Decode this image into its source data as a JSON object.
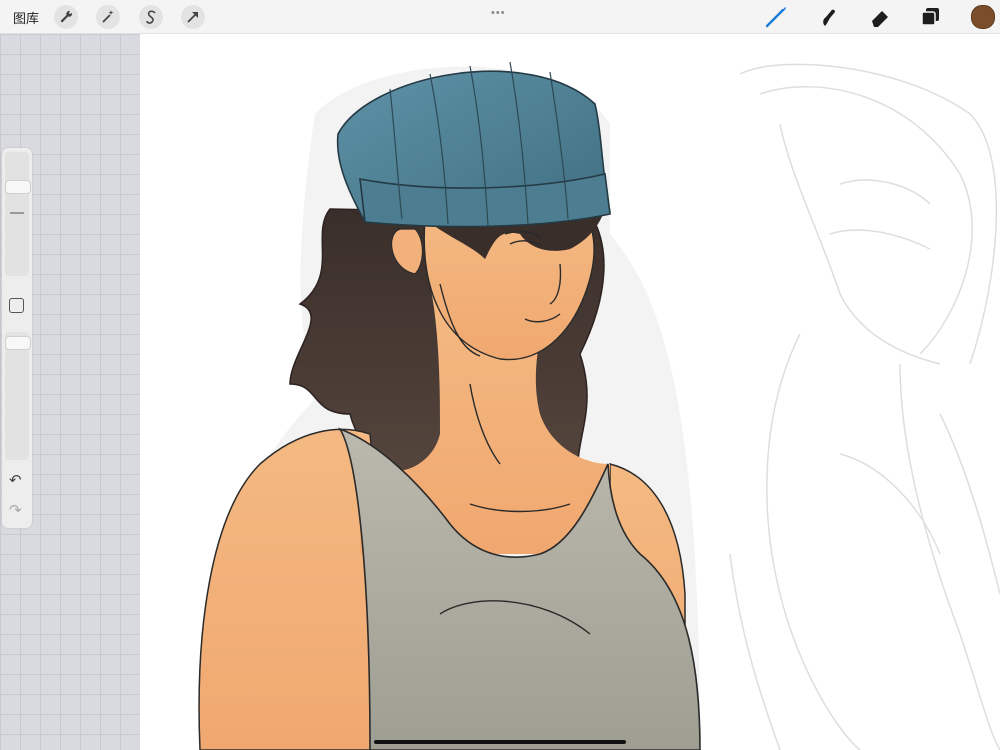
{
  "toolbar": {
    "gallery_label": "图库",
    "left_tools": [
      "wrench-icon",
      "magic-wand-icon",
      "selection-s-icon",
      "transform-arrow-icon"
    ],
    "right_tools": [
      "brush-icon",
      "smudge-icon",
      "eraser-icon",
      "layers-icon"
    ],
    "current_color": "#7a4e2a",
    "active_tool_color": "#1a7bd8"
  },
  "sidebar": {
    "controls": [
      "brush-size-slider",
      "modify-button",
      "opacity-slider",
      "undo-button",
      "redo-button"
    ]
  },
  "canvas": {
    "background": "#ffffff",
    "artwork": "illustration"
  }
}
